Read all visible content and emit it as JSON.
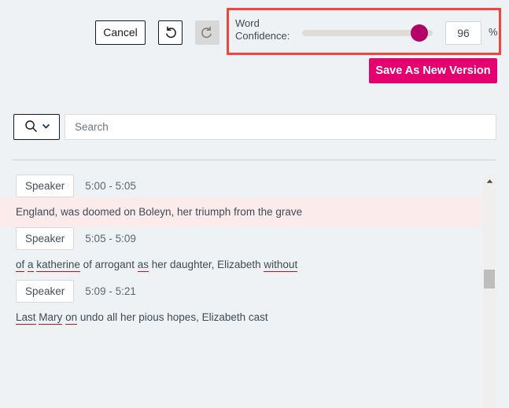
{
  "toolbar": {
    "cancel_label": "Cancel",
    "undo_icon": "undo-arrow-icon",
    "redo_icon": "redo-arrow-icon",
    "save_label": "Save As New Version",
    "save_color": "#e4006e"
  },
  "word_confidence": {
    "label": "Word Confidence:",
    "label_line1": "Word",
    "label_line2": "Confidence:",
    "value": 96,
    "value_text": "96",
    "unit": "%",
    "min": 0,
    "max": 100,
    "slider_fill_percent": 96,
    "thumb_color": "#b5006a",
    "track_color": "#dedbd9",
    "highlight_border_color": "#f2443c"
  },
  "search": {
    "icon": "search-magnifier-icon",
    "dropdown_icon": "chevron-down-icon",
    "placeholder": "Search",
    "value": ""
  },
  "transcript": {
    "highlight_color": "#fbebeb",
    "flag_underline_color": "#cc1111",
    "segments": [
      {
        "speaker": "Speaker",
        "time": "5:00 - 5:05",
        "highlighted": true,
        "text": "England, was doomed on Boleyn, her triumph from the grave",
        "words": [
          {
            "t": "England,",
            "flag": false
          },
          {
            "t": "was",
            "flag": false
          },
          {
            "t": "doomed",
            "flag": false
          },
          {
            "t": "on",
            "flag": false
          },
          {
            "t": "Boleyn,",
            "flag": false
          },
          {
            "t": "her",
            "flag": false
          },
          {
            "t": "triumph",
            "flag": false
          },
          {
            "t": "from",
            "flag": false
          },
          {
            "t": "the",
            "flag": false
          },
          {
            "t": "grave",
            "flag": false
          }
        ]
      },
      {
        "speaker": "Speaker",
        "time": "5:05 - 5:09",
        "highlighted": false,
        "text": "of a katherine of arrogant as her daughter, Elizabeth without",
        "words": [
          {
            "t": "of",
            "flag": true
          },
          {
            "t": "a",
            "flag": true
          },
          {
            "t": "katherine",
            "flag": true
          },
          {
            "t": "of",
            "flag": false
          },
          {
            "t": "arrogant",
            "flag": false
          },
          {
            "t": "as",
            "flag": true
          },
          {
            "t": "her",
            "flag": false
          },
          {
            "t": "daughter,",
            "flag": false
          },
          {
            "t": "Elizabeth",
            "flag": false
          },
          {
            "t": "without",
            "flag": true
          }
        ]
      },
      {
        "speaker": "Speaker",
        "time": "5:09 - 5:21",
        "highlighted": false,
        "text": "Last Mary on undo all her pious hopes, Elizabeth cast",
        "words": [
          {
            "t": "Last",
            "flag": true
          },
          {
            "t": "Mary",
            "flag": true
          },
          {
            "t": "on",
            "flag": true
          },
          {
            "t": "undo",
            "flag": false
          },
          {
            "t": "all",
            "flag": false
          },
          {
            "t": "her",
            "flag": false
          },
          {
            "t": "pious",
            "flag": false
          },
          {
            "t": "hopes,",
            "flag": false
          },
          {
            "t": "Elizabeth",
            "flag": false
          },
          {
            "t": "cast",
            "flag": false
          }
        ]
      }
    ]
  },
  "scrollbar": {
    "up_arrow_icon": "caret-up-icon",
    "thumb_position_percent": 41
  }
}
